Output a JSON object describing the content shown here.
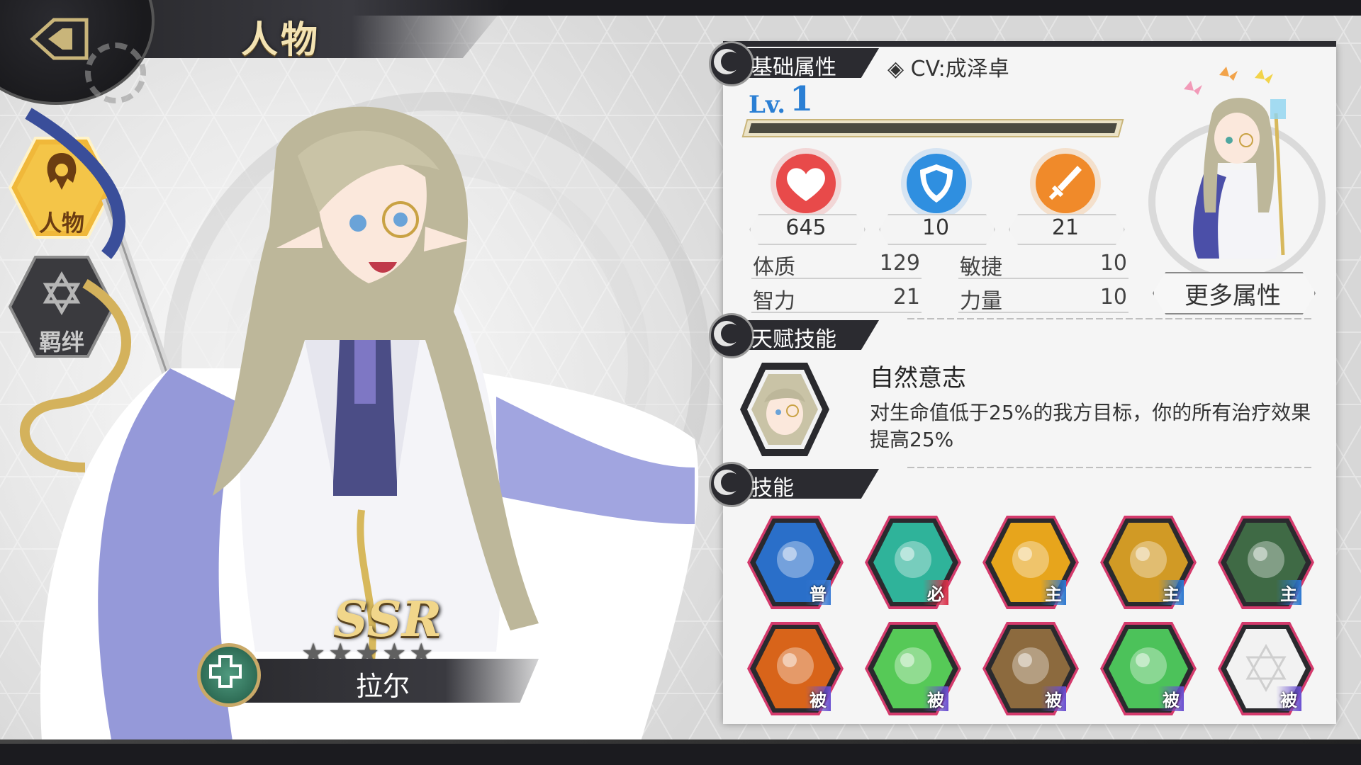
{
  "header": {
    "title": "人物"
  },
  "sidebar": {
    "tabs": [
      {
        "label": "人物",
        "icon": "character-icon",
        "active": true
      },
      {
        "label": "羁绊",
        "icon": "hexagram-icon",
        "active": false
      }
    ]
  },
  "character": {
    "rarity": "SSR",
    "stars": "★★★★★",
    "name": "拉尔",
    "class_icon": "healer-cross-icon"
  },
  "basic_attributes": {
    "section_title": "基础属性",
    "cv": "◈ CV:成泽卓",
    "level_label": "Lv.",
    "level": "1",
    "hp": "645",
    "defense": "10",
    "attack": "21",
    "attrs": [
      {
        "label": "体质",
        "value": "129"
      },
      {
        "label": "敏捷",
        "value": "10"
      },
      {
        "label": "智力",
        "value": "21"
      },
      {
        "label": "力量",
        "value": "10"
      }
    ],
    "more_button": "更多属性"
  },
  "talent": {
    "section_title": "天赋技能",
    "name": "自然意志",
    "description": "对生命值低于25%的我方目标，你的所有治疗效果提高25%"
  },
  "skills": {
    "section_title": "技能",
    "items": [
      {
        "tag": "普",
        "color": "#2a6fc9"
      },
      {
        "tag": "必",
        "color": "#2fb39a"
      },
      {
        "tag": "主",
        "color": "#e7a51c"
      },
      {
        "tag": "主",
        "color": "#d19a25"
      },
      {
        "tag": "主",
        "color": "#3f6a45"
      },
      {
        "tag": "被",
        "color": "#d8641a"
      },
      {
        "tag": "被",
        "color": "#56c957"
      },
      {
        "tag": "被",
        "color": "#8c6a3e"
      },
      {
        "tag": "被",
        "color": "#4cc25a"
      },
      {
        "tag": "被",
        "color": "#f2f2f2"
      }
    ]
  },
  "colors": {
    "hp": "#e84a4a",
    "defense": "#2f8fe0",
    "attack": "#f08a2a",
    "accent_gold": "#f1d68a"
  }
}
